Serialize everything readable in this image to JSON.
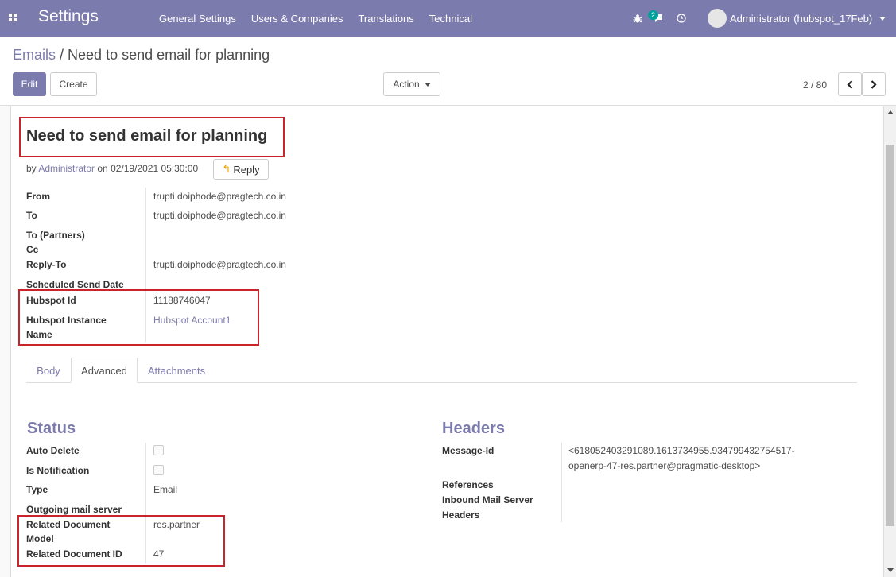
{
  "navbar": {
    "app_title": "Settings",
    "menu": [
      "General Settings",
      "Users & Companies",
      "Translations",
      "Technical"
    ],
    "chat_badge": "2",
    "user_name": "Administrator (hubspot_17Feb)"
  },
  "control_panel": {
    "breadcrumb_parent": "Emails",
    "breadcrumb_separator": " / ",
    "breadcrumb_current": "Need to send email for planning",
    "edit_label": "Edit",
    "create_label": "Create",
    "action_label": "Action",
    "pager": "2 / 80"
  },
  "record": {
    "title": "Need to send email for planning",
    "by_prefix": "by ",
    "author": "Administrator",
    "date_text": " on 02/19/2021 05:30:00",
    "reply_label": "Reply"
  },
  "fields": {
    "from_label": "From",
    "from_value": "trupti.doiphode@pragtech.co.in",
    "to_label": "To",
    "to_value": "trupti.doiphode@pragtech.co.in",
    "to_partners_label": "To (Partners)",
    "cc_label": "Cc",
    "reply_to_label": "Reply-To",
    "reply_to_value": "trupti.doiphode@pragtech.co.in",
    "scheduled_label": "Scheduled Send Date",
    "hubspot_id_label": "Hubspot Id",
    "hubspot_id_value": "11188746047",
    "hubspot_instance_label_1": "Hubspot Instance",
    "hubspot_instance_label_2": "Name",
    "hubspot_instance_value": "Hubspot Account1"
  },
  "tabs": [
    "Body",
    "Advanced",
    "Attachments"
  ],
  "status": {
    "title": "Status",
    "auto_delete_label": "Auto Delete",
    "auto_delete_checked": false,
    "is_notification_label": "Is Notification",
    "is_notification_checked": false,
    "type_label": "Type",
    "type_value": "Email",
    "outgoing_label": "Outgoing mail server",
    "related_model_label_1": "Related Document",
    "related_model_label_2": "Model",
    "related_model_value": "res.partner",
    "related_id_label": "Related Document ID",
    "related_id_value": "47"
  },
  "headers": {
    "title": "Headers",
    "message_id_label": "Message-Id",
    "message_id_line1": "<618052403291089.1613734955.934799432754517-",
    "message_id_line2": "openerp-47-res.partner@pragmatic-desktop>",
    "references_label": "References",
    "inbound_label": "Inbound Mail Server",
    "headers_label": "Headers"
  },
  "colors": {
    "brand": "#7c7bad",
    "highlight_box": "#c9232b",
    "badge": "#00a09d"
  }
}
